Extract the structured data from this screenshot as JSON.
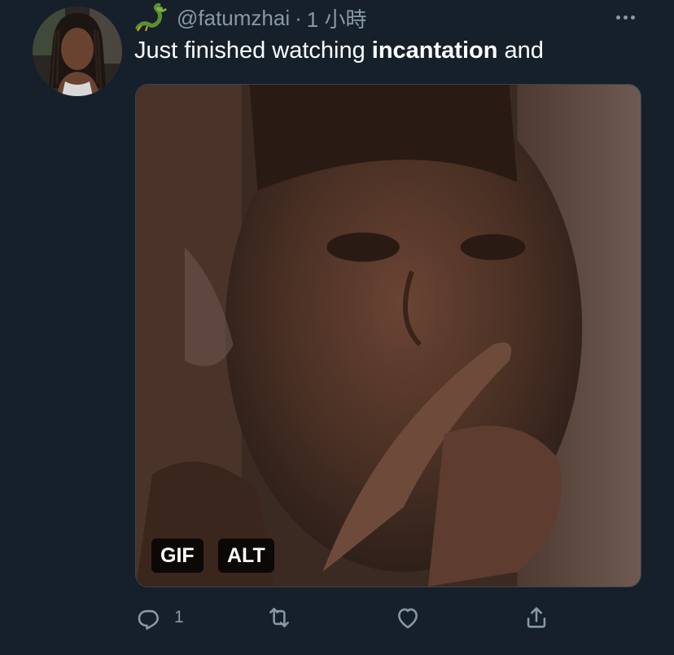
{
  "tweet": {
    "handle": "@fatumzhai",
    "separator": "·",
    "time": "1 小時",
    "text_before": "Just finished watching ",
    "text_bold": "incantation",
    "text_after": " and",
    "media": {
      "gif_badge": "GIF",
      "alt_badge": "ALT"
    },
    "actions": {
      "reply_count": "1",
      "retweet_count": "",
      "like_count": ""
    }
  },
  "icons": {
    "author_emoji": "dragon-icon",
    "more": "more-options-icon",
    "reply": "reply-icon",
    "retweet": "retweet-icon",
    "like": "heart-icon",
    "share": "share-icon"
  },
  "colors": {
    "background": "#15202b",
    "secondary_text": "#8899a6",
    "primary_text": "#ffffff",
    "border": "#38444d"
  }
}
